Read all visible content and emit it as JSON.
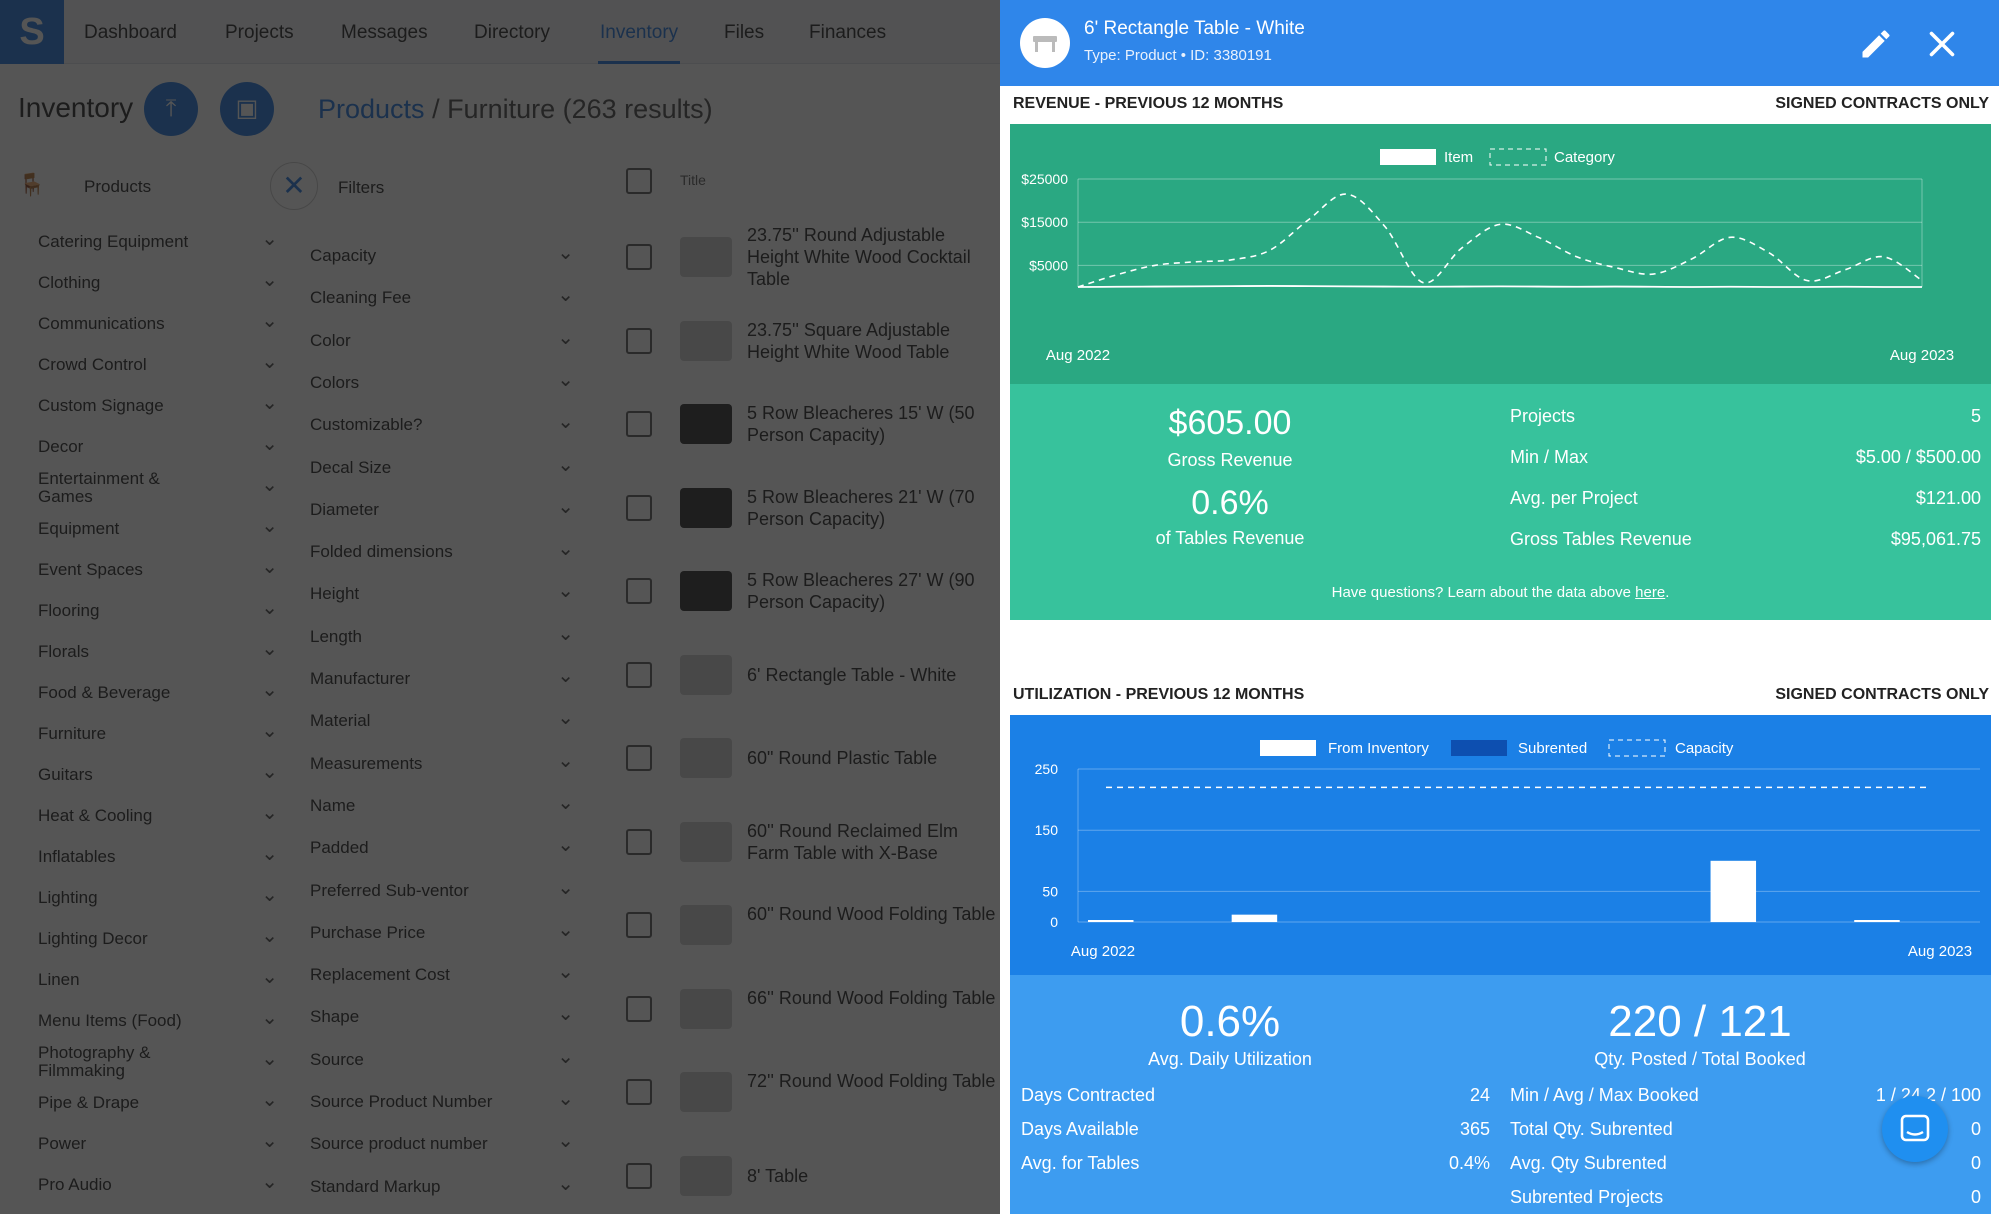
{
  "app": {
    "logo": "S",
    "nav": [
      "Dashboard",
      "Projects",
      "Messages",
      "Directory",
      "Inventory",
      "Files",
      "Finances"
    ],
    "active_nav": "Inventory",
    "inventory_title": "Inventory",
    "breadcrumb": {
      "link": "Products",
      "rest": " / Furniture (263 results)"
    },
    "categories_header": "Products",
    "categories": [
      "Catering Equipment",
      "Clothing",
      "Communications",
      "Crowd Control",
      "Custom Signage",
      "Decor",
      "Entertainment & Games",
      "Equipment",
      "Event Spaces",
      "Flooring",
      "Florals",
      "Food & Beverage",
      "Furniture",
      "Guitars",
      "Heat & Cooling",
      "Inflatables",
      "Lighting",
      "Lighting Decor",
      "Linen",
      "Menu Items (Food)",
      "Photography & Filmmaking",
      "Pipe & Drape",
      "Power",
      "Pro Audio"
    ],
    "filters_header": "Filters",
    "filters": [
      "Capacity",
      "Cleaning Fee",
      "Color",
      "Colors",
      "Customizable?",
      "Decal Size",
      "Diameter",
      "Folded dimensions",
      "Height",
      "Length",
      "Manufacturer",
      "Material",
      "Measurements",
      "Name",
      "Padded",
      "Preferred Sub-ventor",
      "Purchase Price",
      "Replacement Cost",
      "Shape",
      "Source",
      "Source Product Number",
      "Source product number",
      "Standard Markup"
    ],
    "title_column": "Title",
    "products": [
      "23.75'' Round Adjustable Height White Wood Cocktail Table",
      "23.75'' Square Adjustable Height White Wood Table",
      "5 Row Bleacheres 15' W (50 Person Capacity)",
      "5 Row Bleacheres 21' W (70 Person Capacity)",
      "5 Row Bleacheres 27' W (90 Person Capacity)",
      "6' Rectangle Table - White",
      "60\" Round Plastic Table",
      "60'' Round Reclaimed Elm Farm Table with X-Base",
      "60'' Round Wood Folding Table",
      "66'' Round Wood Folding Table",
      "72'' Round Wood Folding Table",
      "8' Table"
    ]
  },
  "panel": {
    "title": "6' Rectangle Table - White",
    "subtitle": "Type: Product • ID: 3380191",
    "icons": {
      "edit": "pencil-icon",
      "close": "close-icon",
      "avatar": "table-icon"
    },
    "revenue": {
      "section_title": "REVENUE - PREVIOUS 12 MONTHS",
      "section_right": "SIGNED CONTRACTS ONLY",
      "legend_item": "Item",
      "legend_category": "Category",
      "gross_revenue_value": "$605.00",
      "gross_revenue_label": "Gross Revenue",
      "share_value": "0.6%",
      "share_label": "of Tables Revenue",
      "stats": [
        {
          "k": "Projects",
          "v": "5"
        },
        {
          "k": "Min / Max",
          "v": "$5.00 / $500.00"
        },
        {
          "k": "Avg. per Project",
          "v": "$121.00"
        },
        {
          "k": "Gross Tables Revenue",
          "v": "$95,061.75"
        }
      ],
      "note_prefix": "Have questions? Learn about the data above ",
      "note_link": "here",
      "note_suffix": "."
    },
    "utilization": {
      "section_title": "UTILIZATION - PREVIOUS 12 MONTHS",
      "section_right": "SIGNED CONTRACTS ONLY",
      "legend_inventory": "From Inventory",
      "legend_subrented": "Subrented",
      "legend_capacity": "Capacity",
      "avg_util_value": "0.6%",
      "avg_util_label": "Avg. Daily Utilization",
      "qty_value": "220 / 121",
      "qty_label": "Qty. Posted / Total Booked",
      "left_stats": [
        {
          "k": "Days Contracted",
          "v": "24"
        },
        {
          "k": "Days Available",
          "v": "365"
        },
        {
          "k": "Avg. for Tables",
          "v": "0.4%"
        }
      ],
      "right_stats": [
        {
          "k": "Min / Avg / Max Booked",
          "v": "1 / 24.2 / 100"
        },
        {
          "k": "Total Qty. Subrented",
          "v": "0"
        },
        {
          "k": "Avg. Qty Subrented",
          "v": "0"
        },
        {
          "k": "Subrented Projects",
          "v": "0"
        }
      ]
    },
    "colors": {
      "header": "#2f86ea",
      "revenue_chart": "#2aa882",
      "revenue_stats": "#37c29c",
      "util_chart": "#1b80e6",
      "util_stats": "#3d9cf0"
    },
    "chat_icon": "chat-icon"
  },
  "chart_data": [
    {
      "type": "line",
      "title": "REVENUE - PREVIOUS 12 MONTHS",
      "x_tick_labels": [
        "Aug 2022",
        "Aug 2023"
      ],
      "y_tick_labels": [
        "$25000",
        "$15000",
        "$5000"
      ],
      "ylim": [
        0,
        25000
      ],
      "grid": true,
      "legend": "top-center",
      "series": [
        {
          "name": "Item",
          "style": "solid",
          "values": [
            0,
            50,
            100,
            150,
            200,
            250,
            200,
            150,
            100,
            50,
            100,
            150,
            100,
            50,
            100,
            50,
            0,
            50,
            0,
            0,
            50,
            0,
            0
          ]
        },
        {
          "name": "Category",
          "style": "dashed",
          "values": [
            0,
            2800,
            5000,
            5800,
            6300,
            8500,
            15500,
            21500,
            14000,
            1000,
            9000,
            14500,
            11500,
            7000,
            4500,
            3000,
            6500,
            11500,
            8000,
            1500,
            4000,
            7000,
            1500
          ]
        }
      ]
    },
    {
      "type": "bar",
      "title": "UTILIZATION - PREVIOUS 12 MONTHS",
      "x_tick_labels": [
        "Aug 2022",
        "Aug 2023"
      ],
      "y_tick_labels": [
        "250",
        "150",
        "50",
        "0"
      ],
      "ylim": [
        0,
        250
      ],
      "grid": true,
      "legend": "top-center",
      "capacity": 220,
      "series": [
        {
          "name": "From Inventory",
          "values": [
            1,
            0,
            0,
            12,
            0,
            0,
            0,
            0,
            0,
            0,
            0,
            0,
            0,
            100,
            0,
            0,
            1,
            0
          ]
        },
        {
          "name": "Subrented",
          "values": [
            0,
            0,
            0,
            0,
            0,
            0,
            0,
            0,
            0,
            0,
            0,
            0,
            0,
            0,
            0,
            0,
            0,
            0
          ]
        }
      ]
    }
  ]
}
